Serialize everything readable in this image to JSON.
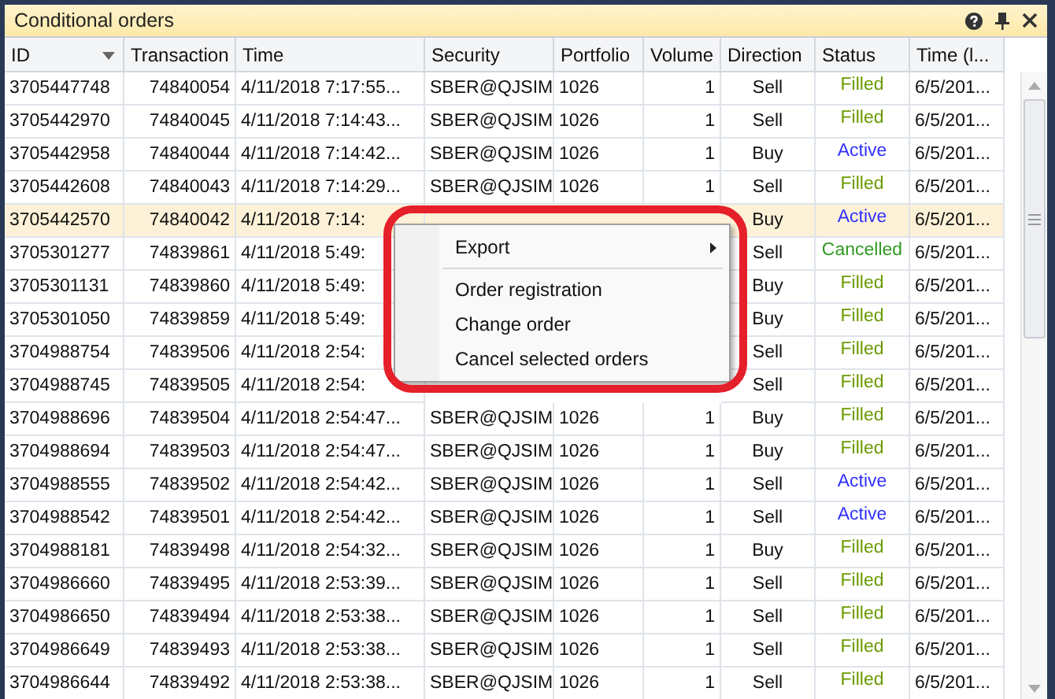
{
  "panel": {
    "title": "Conditional orders"
  },
  "columns": [
    {
      "label": "ID",
      "sorted": true
    },
    {
      "label": "Transaction",
      "sorted": false
    },
    {
      "label": "Time",
      "sorted": false
    },
    {
      "label": "Security",
      "sorted": false
    },
    {
      "label": "Portfolio",
      "sorted": false
    },
    {
      "label": "Volume",
      "sorted": false
    },
    {
      "label": "Direction",
      "sorted": false
    },
    {
      "label": "Status",
      "sorted": false
    },
    {
      "label": "Time (l...",
      "sorted": false
    }
  ],
  "rows": [
    {
      "id": "3705447748",
      "transaction": "74840054",
      "time": "4/11/2018 7:17:55...",
      "security": "SBER@QJSIM",
      "portfolio": "1026",
      "volume": "1",
      "direction": "Sell",
      "status": {
        "label": "Filled",
        "color": "#6a9a00"
      },
      "time_local": "6/5/201...",
      "selected": false
    },
    {
      "id": "3705442970",
      "transaction": "74840045",
      "time": "4/11/2018 7:14:43...",
      "security": "SBER@QJSIM",
      "portfolio": "1026",
      "volume": "1",
      "direction": "Sell",
      "status": {
        "label": "Filled",
        "color": "#6a9a00"
      },
      "time_local": "6/5/201...",
      "selected": false
    },
    {
      "id": "3705442958",
      "transaction": "74840044",
      "time": "4/11/2018 7:14:42...",
      "security": "SBER@QJSIM",
      "portfolio": "1026",
      "volume": "1",
      "direction": "Buy",
      "status": {
        "label": "Active",
        "color": "#3030ff"
      },
      "time_local": "6/5/201...",
      "selected": false
    },
    {
      "id": "3705442608",
      "transaction": "74840043",
      "time": "4/11/2018 7:14:29...",
      "security": "SBER@QJSIM",
      "portfolio": "1026",
      "volume": "1",
      "direction": "Sell",
      "status": {
        "label": "Filled",
        "color": "#6a9a00"
      },
      "time_local": "6/5/201...",
      "selected": false
    },
    {
      "id": "3705442570",
      "transaction": "74840042",
      "time": "4/11/2018 7:14:",
      "direction": "Buy",
      "status": {
        "label": "Active",
        "color": "#3030ff"
      },
      "time_local": "6/5/201...",
      "selected": true
    },
    {
      "id": "3705301277",
      "transaction": "74839861",
      "time": "4/11/2018 5:49:",
      "direction": "Sell",
      "status": {
        "label": "Cancelled",
        "color": "#2f9a20"
      },
      "time_local": "6/5/201...",
      "selected": false
    },
    {
      "id": "3705301131",
      "transaction": "74839860",
      "time": "4/11/2018 5:49:",
      "direction": "Buy",
      "status": {
        "label": "Filled",
        "color": "#6a9a00"
      },
      "time_local": "6/5/201...",
      "selected": false
    },
    {
      "id": "3705301050",
      "transaction": "74839859",
      "time": "4/11/2018 5:49:",
      "direction": "Buy",
      "status": {
        "label": "Filled",
        "color": "#6a9a00"
      },
      "time_local": "6/5/201...",
      "selected": false
    },
    {
      "id": "3704988754",
      "transaction": "74839506",
      "time": "4/11/2018 2:54:",
      "direction": "Sell",
      "status": {
        "label": "Filled",
        "color": "#6a9a00"
      },
      "time_local": "6/5/201...",
      "selected": false
    },
    {
      "id": "3704988745",
      "transaction": "74839505",
      "time": "4/11/2018 2:54:",
      "direction": "Sell",
      "status": {
        "label": "Filled",
        "color": "#6a9a00"
      },
      "time_local": "6/5/201...",
      "selected": false
    },
    {
      "id": "3704988696",
      "transaction": "74839504",
      "time": "4/11/2018 2:54:47...",
      "security": "SBER@QJSIM",
      "portfolio": "1026",
      "volume": "1",
      "direction": "Buy",
      "status": {
        "label": "Filled",
        "color": "#6a9a00"
      },
      "time_local": "6/5/201...",
      "selected": false
    },
    {
      "id": "3704988694",
      "transaction": "74839503",
      "time": "4/11/2018 2:54:47...",
      "security": "SBER@QJSIM",
      "portfolio": "1026",
      "volume": "1",
      "direction": "Buy",
      "status": {
        "label": "Filled",
        "color": "#6a9a00"
      },
      "time_local": "6/5/201...",
      "selected": false
    },
    {
      "id": "3704988555",
      "transaction": "74839502",
      "time": "4/11/2018 2:54:42...",
      "security": "SBER@QJSIM",
      "portfolio": "1026",
      "volume": "1",
      "direction": "Sell",
      "status": {
        "label": "Active",
        "color": "#3030ff"
      },
      "time_local": "6/5/201...",
      "selected": false
    },
    {
      "id": "3704988542",
      "transaction": "74839501",
      "time": "4/11/2018 2:54:42...",
      "security": "SBER@QJSIM",
      "portfolio": "1026",
      "volume": "1",
      "direction": "Sell",
      "status": {
        "label": "Active",
        "color": "#3030ff"
      },
      "time_local": "6/5/201...",
      "selected": false
    },
    {
      "id": "3704988181",
      "transaction": "74839498",
      "time": "4/11/2018 2:54:32...",
      "security": "SBER@QJSIM",
      "portfolio": "1026",
      "volume": "1",
      "direction": "Buy",
      "status": {
        "label": "Filled",
        "color": "#6a9a00"
      },
      "time_local": "6/5/201...",
      "selected": false
    },
    {
      "id": "3704986660",
      "transaction": "74839495",
      "time": "4/11/2018 2:53:39...",
      "security": "SBER@QJSIM",
      "portfolio": "1026",
      "volume": "1",
      "direction": "Sell",
      "status": {
        "label": "Filled",
        "color": "#6a9a00"
      },
      "time_local": "6/5/201...",
      "selected": false
    },
    {
      "id": "3704986650",
      "transaction": "74839494",
      "time": "4/11/2018 2:53:38...",
      "security": "SBER@QJSIM",
      "portfolio": "1026",
      "volume": "1",
      "direction": "Sell",
      "status": {
        "label": "Filled",
        "color": "#6a9a00"
      },
      "time_local": "6/5/201...",
      "selected": false
    },
    {
      "id": "3704986649",
      "transaction": "74839493",
      "time": "4/11/2018 2:53:38...",
      "security": "SBER@QJSIM",
      "portfolio": "1026",
      "volume": "1",
      "direction": "Sell",
      "status": {
        "label": "Filled",
        "color": "#6a9a00"
      },
      "time_local": "6/5/201...",
      "selected": false
    },
    {
      "id": "3704986644",
      "transaction": "74839492",
      "time": "4/11/2018 2:53:38...",
      "security": "SBER@QJSIM",
      "portfolio": "1026",
      "volume": "1",
      "direction": "Sell",
      "status": {
        "label": "Filled",
        "color": "#6a9a00"
      },
      "time_local": "6/5/201...",
      "selected": false
    }
  ],
  "context_menu": {
    "items": [
      {
        "kind": "submenu",
        "label": "Export"
      },
      {
        "kind": "separator"
      },
      {
        "kind": "item",
        "label": "Order registration"
      },
      {
        "kind": "item",
        "label": "Change order"
      },
      {
        "kind": "item",
        "label": "Cancel selected orders"
      }
    ]
  },
  "annotation": {
    "kind": "outline"
  }
}
